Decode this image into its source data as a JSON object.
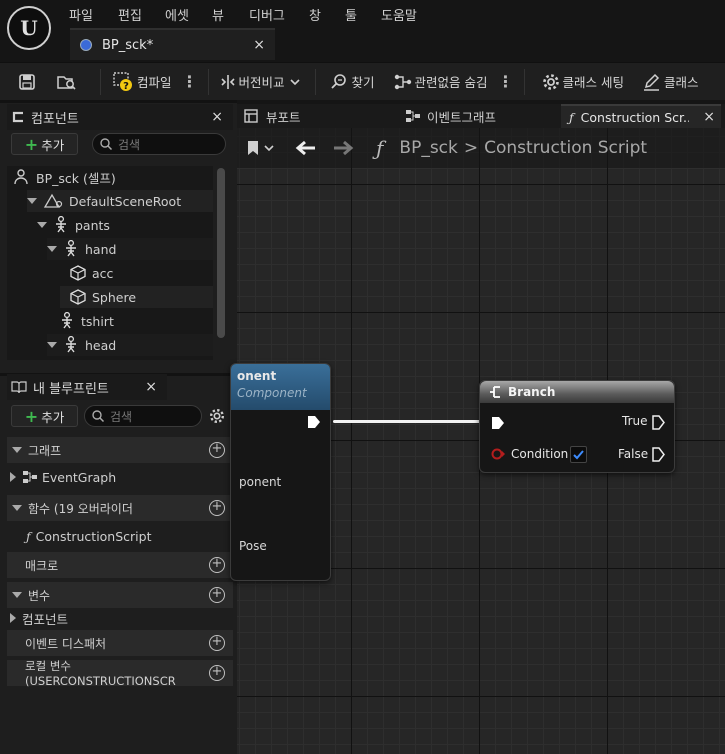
{
  "menu": [
    "파일",
    "편집",
    "에셋",
    "뷰",
    "디버그",
    "창",
    "툴",
    "도움말"
  ],
  "logo_text": "U",
  "document_tab": {
    "title": "BP_sck*",
    "close": "×"
  },
  "toolbar": {
    "compile": "컴파일",
    "diff": "버전비교",
    "find": "찾기",
    "hide_unrelated": "관련없음 숨김",
    "class_settings": "클래스 세팅",
    "class_defaults": "클래스"
  },
  "components_panel": {
    "title": "컴포넌트",
    "close": "×",
    "add_label": "추가",
    "search_placeholder": "검색",
    "tree": [
      {
        "label": "BP_sck (셀프)"
      },
      {
        "label": "DefaultSceneRoot"
      },
      {
        "label": "pants"
      },
      {
        "label": "hand"
      },
      {
        "label": "acc"
      },
      {
        "label": "Sphere"
      },
      {
        "label": "tshirt"
      },
      {
        "label": "head"
      }
    ]
  },
  "blueprint_panel": {
    "title": "내 블루프린트",
    "close": "×",
    "add_label": "추가",
    "search_placeholder": "검색",
    "sections": {
      "graphs": "그래프",
      "event_graph": "EventGraph",
      "functions": "함수 (19 오버라이더",
      "construction_script": "ConstructionScript",
      "macros": "매크로",
      "variables": "변수",
      "components": "컴포넌트",
      "event_dispatchers": "이벤트 디스패처",
      "local_variables": "로컬 변수 (USERCONSTRUCTIONSCR"
    }
  },
  "graph_tabs": {
    "viewport": "뷰포트",
    "event_graph": "이벤트그래프",
    "construction": "Construction Scr...",
    "close": "×"
  },
  "breadcrumb": {
    "blueprint": "BP_sck",
    "separator": ">",
    "graph": "Construction Script"
  },
  "node_left": {
    "title": "onent",
    "subtitle": "Component",
    "pin1": "ponent",
    "pin2": "Pose"
  },
  "branch_node": {
    "title": "Branch",
    "true_label": "True",
    "condition_label": "Condition",
    "false_label": "False",
    "condition_checked": true
  },
  "colors": {
    "accent_blue": "#1f6feb",
    "add_green": "#3fb950",
    "condition_pin": "#b31d1d",
    "node_header_left": "#2f5f83"
  }
}
